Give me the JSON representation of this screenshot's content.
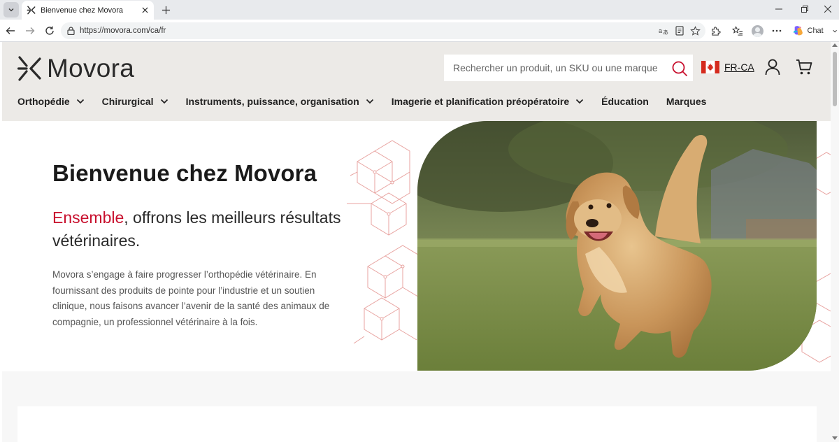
{
  "browser": {
    "tab_title": "Bienvenue chez Movora",
    "url": "https://movora.com/ca/fr",
    "chat_label": "Chat"
  },
  "site": {
    "logo_text": "Movora",
    "search_placeholder": "Rechercher un produit, un SKU ou une marque",
    "language_label": "FR-CA",
    "brand_color": "#c8102e",
    "nav": [
      {
        "label": "Orthopédie",
        "has_dropdown": true
      },
      {
        "label": "Chirurgical",
        "has_dropdown": true
      },
      {
        "label": "Instruments, puissance, organisation",
        "has_dropdown": true
      },
      {
        "label": "Imagerie et planification préopératoire",
        "has_dropdown": true
      },
      {
        "label": "Éducation",
        "has_dropdown": false
      },
      {
        "label": "Marques",
        "has_dropdown": false
      }
    ]
  },
  "hero": {
    "title": "Bienvenue chez Movora",
    "subtitle_accent": "Ensemble",
    "subtitle_rest": ", offrons les meilleurs résultats vétérinaires.",
    "body": "Movora s’engage à faire progresser l’orthopédie vétérinaire. En fournissant des produits de pointe pour l’industrie et un soutien clinique, nous faisons avancer l’avenir de la santé des animaux de compagnie, un professionnel vétérinaire à la fois."
  }
}
